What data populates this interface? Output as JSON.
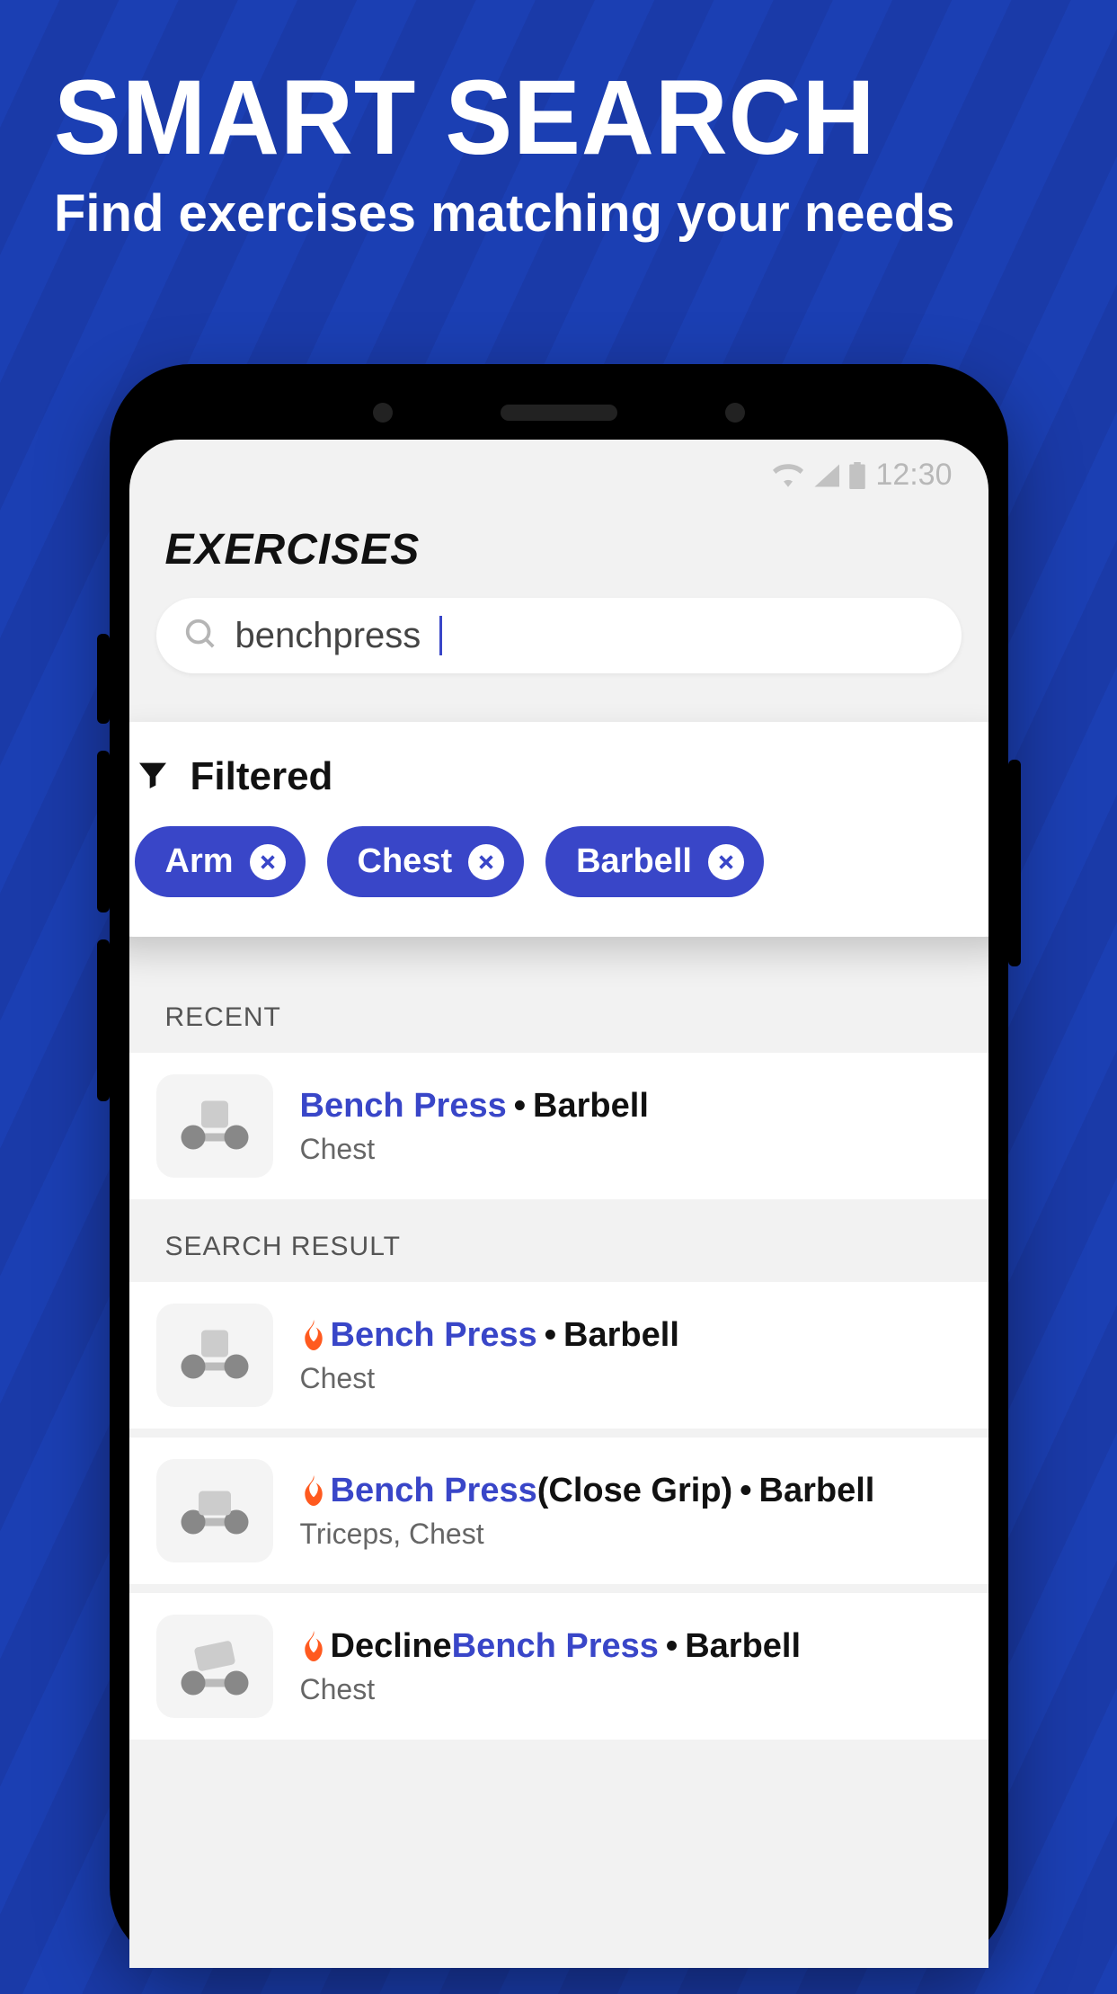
{
  "promo": {
    "title": "SMART SEARCH",
    "subtitle": "Find exercises matching your needs"
  },
  "status": {
    "time": "12:30"
  },
  "page": {
    "title": "EXERCISES"
  },
  "search": {
    "value": "benchpress"
  },
  "filter": {
    "label": "Filtered",
    "chips": [
      {
        "label": "Arm"
      },
      {
        "label": "Chest"
      },
      {
        "label": "Barbell"
      }
    ]
  },
  "sections": {
    "recent_label": "RECENT",
    "results_label": "SEARCH RESULT"
  },
  "recent": [
    {
      "name_hl": "Bench Press",
      "equipment": "Barbell",
      "muscle": "Chest",
      "hot": false
    }
  ],
  "results": [
    {
      "prefix": "",
      "name_hl": "Bench Press",
      "suffix": "",
      "equipment": "Barbell",
      "muscle": "Chest",
      "hot": true
    },
    {
      "prefix": "",
      "name_hl": "Bench Press",
      "suffix": "(Close Grip)",
      "equipment": "Barbell",
      "muscle": "Triceps, Chest",
      "hot": true
    },
    {
      "prefix": "Decline ",
      "name_hl": "Bench Press",
      "suffix": "",
      "equipment": "Barbell",
      "muscle": "Chest",
      "hot": true
    }
  ]
}
